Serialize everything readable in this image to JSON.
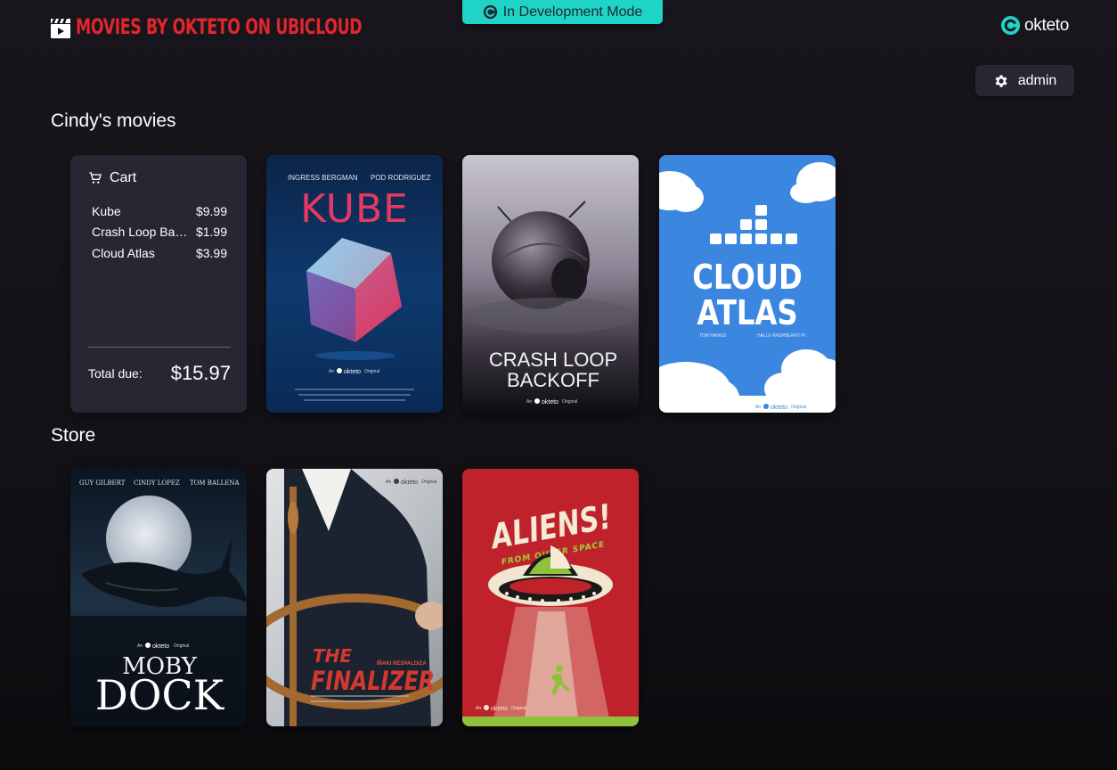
{
  "header": {
    "app_title": "MOVIES BY OKTETO ON UBICLOUD",
    "dev_mode_label": "In Development Mode",
    "logo_text": "okteto",
    "admin_label": "admin"
  },
  "colors": {
    "brand_red": "#e0262e",
    "accent_teal": "#1fd3c6",
    "card_bg": "#2a2532",
    "page_bg": "#141217"
  },
  "rented": {
    "title": "Cindy's movies",
    "cart": {
      "title": "Cart",
      "items": [
        {
          "name": "Kube",
          "price": "$9.99"
        },
        {
          "name": "Crash Loop Backoff",
          "price": "$1.99"
        },
        {
          "name": "Cloud Atlas",
          "price": "$3.99"
        }
      ],
      "total_label": "Total due:",
      "total_amount": "$15.97"
    },
    "posters": [
      {
        "id": "kube",
        "credit_left": "INGRESS BERGMAN",
        "credit_right": "POD RODRIGUEZ",
        "title": "KUBE",
        "tag": "Original"
      },
      {
        "id": "crash",
        "title_line1": "CRASH LOOP",
        "title_line2": "BACKOFF",
        "tag": "Original"
      },
      {
        "id": "cloud",
        "title_line1": "CLOUD",
        "title_line2": "ATLAS",
        "credit_left": "TOM HANGS",
        "credit_right": "HALLE RASPBERRY PI",
        "tag": "Original"
      }
    ]
  },
  "store": {
    "title": "Store",
    "posters": [
      {
        "id": "moby",
        "credits": [
          "GUY GILBERT",
          "CINDY LOPEZ",
          "TOM BALLENA"
        ],
        "title_line1": "MOBY",
        "title_line2": "DOCK",
        "tag": "Original"
      },
      {
        "id": "finalizer",
        "credit": "IÑAKI RESPALDIZA",
        "title_line1": "THE",
        "title_line2": "FINALIZER",
        "tag": "Original"
      },
      {
        "id": "aliens",
        "title": "ALIENS!",
        "subtitle": "FROM OUTER SPACE",
        "tag": "Original"
      }
    ]
  }
}
